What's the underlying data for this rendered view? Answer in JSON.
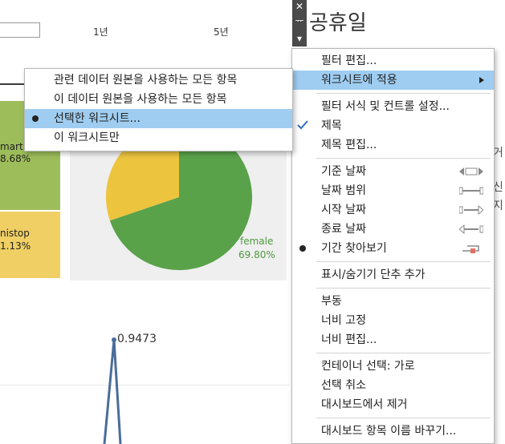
{
  "dashboard": {
    "range_labels": [
      "1년",
      "5년"
    ],
    "treemap": [
      {
        "label": "mart",
        "value": "8.68%"
      },
      {
        "label": "nistop",
        "value": "1.13%"
      }
    ],
    "pie": {
      "slices": [
        {
          "label": "female",
          "percent": 69.8,
          "color": "#5aa24a"
        },
        {
          "label": "",
          "percent": 30.2,
          "color": "#ecc43e"
        }
      ],
      "female_label": "female",
      "female_value": "69.80%"
    },
    "line_peak_label": "0.9473"
  },
  "control_strip": {
    "close": "✕",
    "pin": "ᅲ",
    "dropdown": "▾"
  },
  "right_pane": {
    "title_fragment": "공휴일",
    "fragments": [
      "거",
      "신",
      "지"
    ]
  },
  "context_menu": {
    "edit_filter": "필터 편집...",
    "apply_to_worksheets": "워크시트에 적용",
    "format_filters": "필터 서식 및 컨트롤 설정...",
    "title": "제목",
    "edit_title": "제목 편집...",
    "relative_date": "기준 날짜",
    "date_range": "날짜 범위",
    "start_date": "시작 날짜",
    "end_date": "종료 날짜",
    "browse_periods": "기간 찾아보기",
    "add_show_hide": "표시/숨기기 단추 추가",
    "floating": "부동",
    "fix_width": "너비 고정",
    "edit_width": "너비 편집...",
    "select_container": "컨테이너 선택: 가로",
    "deselect": "선택 취소",
    "remove_from_dashboard": "대시보드에서 제거",
    "rename_item": "대시보드 항목 이름 바꾸기..."
  },
  "submenu": {
    "related_sources": "관련 데이터 원본을 사용하는 모든 항목",
    "this_source": "이 데이터 원본을 사용하는 모든 항목",
    "selected_worksheets": "선택한 워크시트...",
    "only_this": "이 워크시트만"
  },
  "colors": {
    "highlight": "#9fcdf1",
    "treemap_green": "#9dbd5a",
    "treemap_yellow": "#f0d064"
  }
}
